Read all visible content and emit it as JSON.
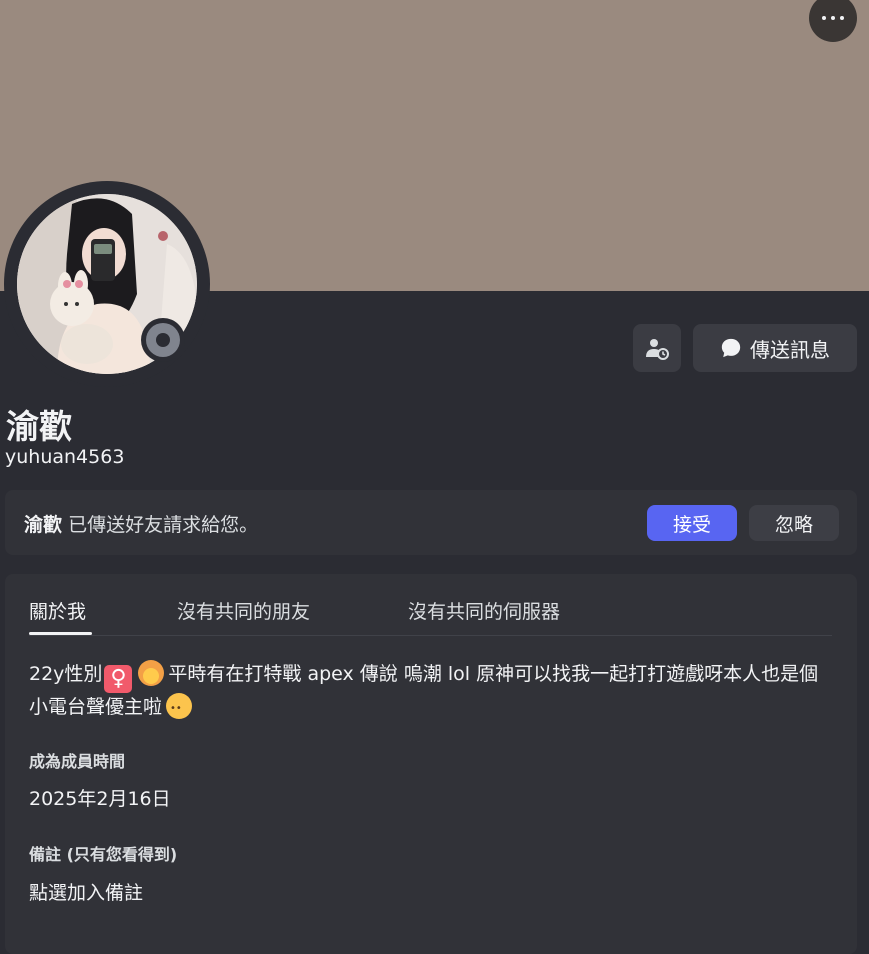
{
  "banner": {
    "color": "#9a8a7f"
  },
  "profile": {
    "display_name": "渝歡",
    "username": "yuhuan4563",
    "status": "offline"
  },
  "actions": {
    "add_friend_icon": "user-clock-icon",
    "send_message_label": "傳送訊息"
  },
  "friend_request": {
    "name": "渝歡",
    "text": "已傳送好友請求給您。",
    "accept_label": "接受",
    "ignore_label": "忽略"
  },
  "tabs": [
    {
      "label": "關於我",
      "active": true
    },
    {
      "label": "沒有共同的朋友",
      "active": false
    },
    {
      "label": "沒有共同的伺服器",
      "active": false
    }
  ],
  "about": {
    "bio_part1": "22y性別",
    "bio_part2": "平時有在打特戰 apex 傳說 嗚潮 lol 原神可以找我一起打打遊戲呀本人也是個小電台聲優主啦",
    "member_since_title": "成為成員時間",
    "member_since_value": "2025年2月16日",
    "note_title": "備註 (只有您看得到)",
    "note_placeholder": "點選加入備註"
  },
  "colors": {
    "accent": "#5865f2",
    "background": "#2b2c33",
    "card": "#313238"
  }
}
